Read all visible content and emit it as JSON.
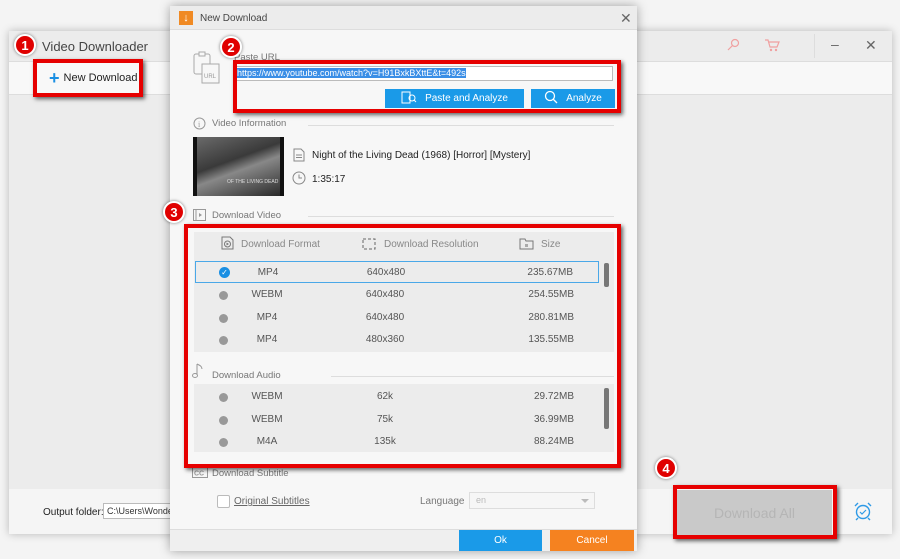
{
  "main_window": {
    "title": "Video Downloader",
    "new_download_label": "New Download",
    "output_folder_label": "Output folder:",
    "output_folder_value": "C:\\Users\\Wonder",
    "download_all_label": "Download All",
    "icons": [
      "key-icon",
      "cart-icon",
      "minimize-icon",
      "close-icon",
      "alarm-clock-icon"
    ]
  },
  "dialog": {
    "title": "New Download",
    "paste_url_label": "Paste URL",
    "url_value": "https://www.youtube.com/watch?v=H91BxkBXttE&t=492s",
    "paste_analyze_label": "Paste and Analyze",
    "analyze_label": "Analyze",
    "video_info_label": "Video Information",
    "video_title": "Night of the Living Dead (1968) [Horror] [Mystery]",
    "video_duration": "1:35:17",
    "thumbnail_caption": "OF THE LIVING DEAD",
    "download_video_label": "Download Video",
    "columns": {
      "format": "Download Format",
      "resolution": "Download Resolution",
      "size": "Size"
    },
    "video_rows": [
      {
        "format": "MP4",
        "resolution": "640x480",
        "size": "235.67MB",
        "selected": true
      },
      {
        "format": "WEBM",
        "resolution": "640x480",
        "size": "254.55MB",
        "selected": false
      },
      {
        "format": "MP4",
        "resolution": "640x480",
        "size": "280.81MB",
        "selected": false
      },
      {
        "format": "MP4",
        "resolution": "480x360",
        "size": "135.55MB",
        "selected": false
      }
    ],
    "download_audio_label": "Download Audio",
    "audio_rows": [
      {
        "format": "WEBM",
        "bitrate": "62k",
        "size": "29.72MB"
      },
      {
        "format": "WEBM",
        "bitrate": "75k",
        "size": "36.99MB"
      },
      {
        "format": "M4A",
        "bitrate": "135k",
        "size": "88.24MB"
      }
    ],
    "download_subtitle_label": "Download Subtitle",
    "original_subtitles_label": "Original Subtitles",
    "original_subtitles_checked": false,
    "language_label": "Language",
    "language_value": "en",
    "ok_label": "Ok",
    "cancel_label": "Cancel"
  },
  "annotations": {
    "badges": [
      "1",
      "2",
      "3",
      "4"
    ],
    "color": "#e60000"
  },
  "colors": {
    "accent_blue": "#1a9ae8",
    "cancel_orange": "#f58220",
    "app_orange": "#f08a24"
  }
}
